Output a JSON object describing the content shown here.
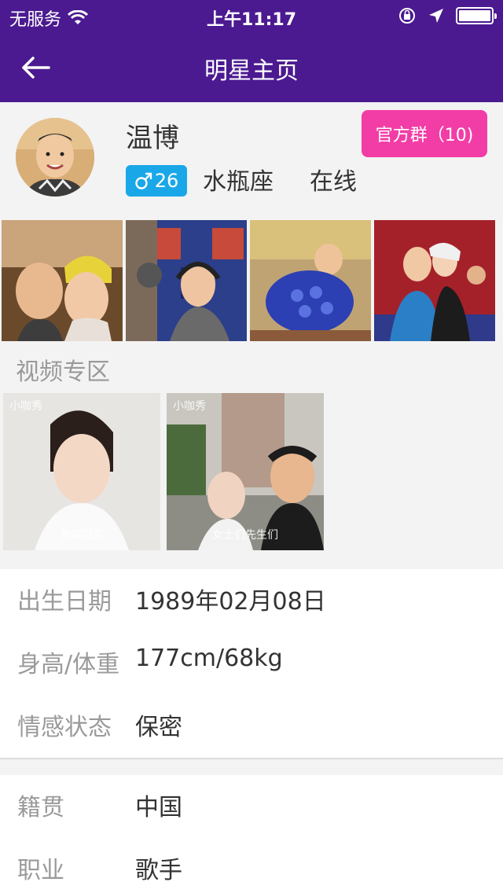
{
  "status_bar": {
    "carrier": "无服务",
    "time": "上午11:17"
  },
  "nav": {
    "title": "明星主页"
  },
  "profile": {
    "name": "温博",
    "age": "26",
    "zodiac": "水瓶座",
    "online": "在线",
    "group_button": "官方群（10)"
  },
  "video_section": {
    "title": "视频专区",
    "videos": [
      {
        "caption": "我叫白芸",
        "watermark": "小咖秀"
      },
      {
        "caption": "女士们先生们",
        "watermark": "小咖秀"
      }
    ]
  },
  "details": {
    "birth_label": "出生日期",
    "birth_value": "1989年02月08日",
    "height_label": "身高/体重",
    "height_value": "177cm/68kg",
    "relationship_label": "情感状态",
    "relationship_value": "保密",
    "hometown_label": "籍贯",
    "hometown_value": "中国",
    "job_label": "职业",
    "job_value": "歌手"
  },
  "colors": {
    "accent": "#4b1a90",
    "group_button": "#f23da6",
    "gender_badge": "#1aa7e8"
  }
}
